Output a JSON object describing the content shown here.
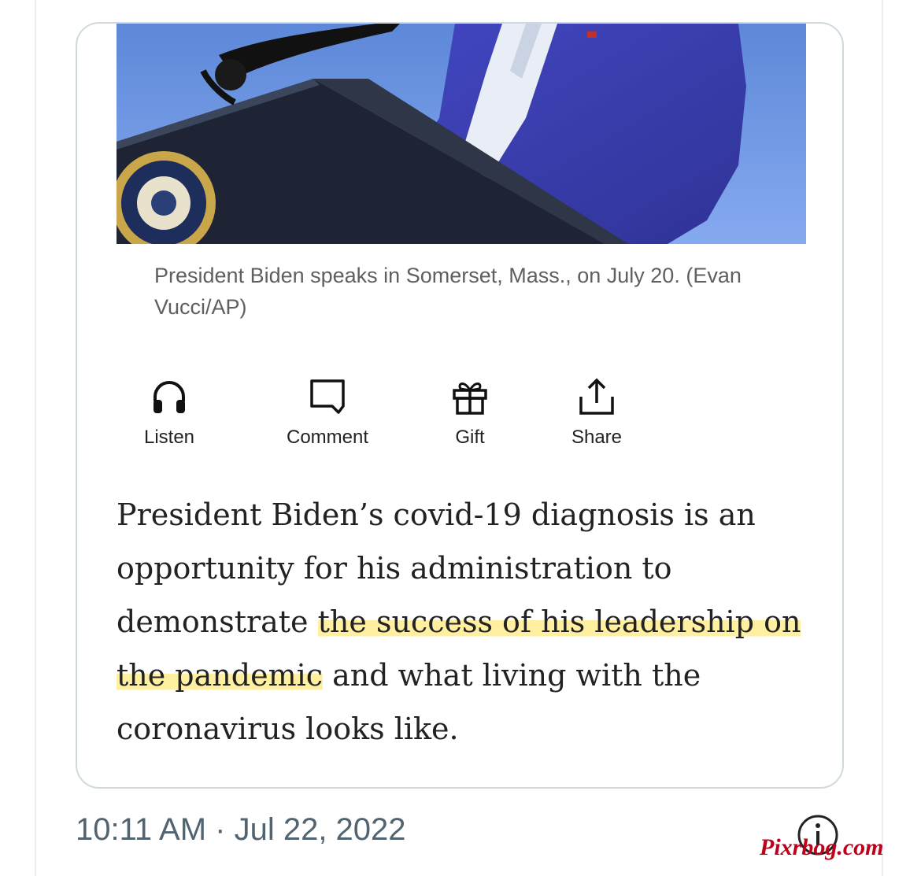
{
  "article_card": {
    "photo_caption": "President Biden speaks in Somerset, Mass., on July 20. (Evan Vucci/AP)",
    "actions": [
      {
        "label": "Listen",
        "icon": "headphones-icon"
      },
      {
        "label": "Comment",
        "icon": "comment-icon"
      },
      {
        "label": "Gift",
        "icon": "gift-icon"
      },
      {
        "label": "Share",
        "icon": "share-icon"
      }
    ],
    "body": {
      "part1": "President Biden’s covid-19 diagnosis is an opportunity for his administration to demonstrate ",
      "highlight": "the success of his leadership on the pandemic",
      "part2": " and what living with the coronavirus looks like."
    }
  },
  "tweet_meta": {
    "timestamp": "10:11 AM · Jul 22, 2022",
    "info_icon": "info-icon"
  },
  "watermark": "Pixrbog.com",
  "colors": {
    "highlight": "#ffea80",
    "suit_blue": "#3a3fb0",
    "sky_blue": "#6f98e0",
    "card_border": "#cfd9de",
    "timestamp_gray": "#536471"
  }
}
